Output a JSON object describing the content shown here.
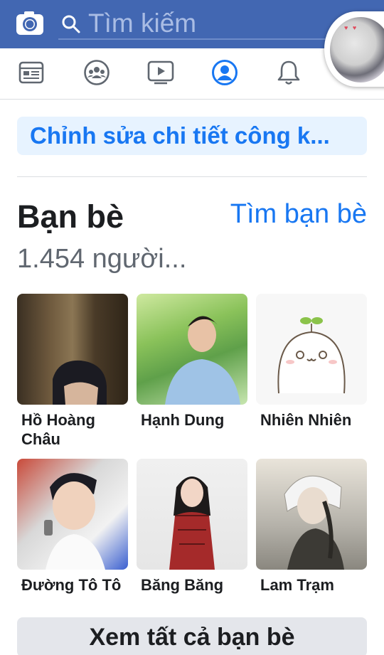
{
  "search": {
    "placeholder": "Tìm kiếm"
  },
  "nav_tabs": [
    {
      "icon": "news-feed-icon"
    },
    {
      "icon": "groups-icon"
    },
    {
      "icon": "watch-icon"
    },
    {
      "icon": "profile-icon",
      "active": true
    },
    {
      "icon": "notifications-icon"
    }
  ],
  "profile": {
    "edit_details_label": "Chỉnh sửa chi tiết công k..."
  },
  "friends": {
    "title": "Bạn bè",
    "find_label": "Tìm bạn bè",
    "count_text": "1.454 người...",
    "list": [
      {
        "name": "Hồ Hoàng Châu"
      },
      {
        "name": "Hạnh Dung"
      },
      {
        "name": "Nhiên Nhiên"
      },
      {
        "name": "Đường Tô Tô"
      },
      {
        "name": "Băng Băng"
      },
      {
        "name": "Lam Trạm"
      }
    ],
    "see_all_label": "Xem tất cả bạn bè"
  },
  "colors": {
    "brand": "#4267b2",
    "link": "#1877f2",
    "edit_bg": "#e7f3ff"
  }
}
